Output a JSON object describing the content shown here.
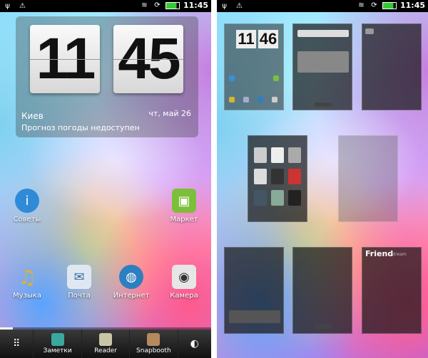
{
  "status_bar": {
    "left_icons": [
      "usb-icon",
      "warning-icon"
    ],
    "right_icons": [
      "wifi-icon",
      "sync-icon",
      "battery-icon"
    ],
    "time": "11:45"
  },
  "clock_widget": {
    "hours": "11",
    "minutes": "45",
    "city": "Киев",
    "weather": "Прогноз погоды недоступен",
    "date": "чт, май 26"
  },
  "apps": [
    {
      "label": "Советы",
      "icon": "info-icon",
      "color": "#2f8ad8"
    },
    {
      "label": "Маркет",
      "icon": "market-icon",
      "color": "#7cbf3a"
    },
    {
      "label": "Музыка",
      "icon": "music-icon",
      "color": "#c9a21f"
    },
    {
      "label": "Почта",
      "icon": "mail-icon",
      "color": "#9fb6d0"
    },
    {
      "label": "Интернет",
      "icon": "globe-icon",
      "color": "#2c7fc0"
    },
    {
      "label": "Камера",
      "icon": "camera-icon",
      "color": "#555"
    }
  ],
  "dock": [
    {
      "label": "",
      "icon": "all-apps-icon"
    },
    {
      "label": "Заметки",
      "icon": "notes-icon"
    },
    {
      "label": "Reader",
      "icon": "reader-icon"
    },
    {
      "label": "Snapbooth",
      "icon": "snapbooth-icon"
    },
    {
      "label": "",
      "icon": "personalize-icon"
    }
  ],
  "right_panel": {
    "clock_hours": "11",
    "clock_minutes": "46",
    "friend_title": "Friend",
    "friend_sub": "Stream"
  }
}
